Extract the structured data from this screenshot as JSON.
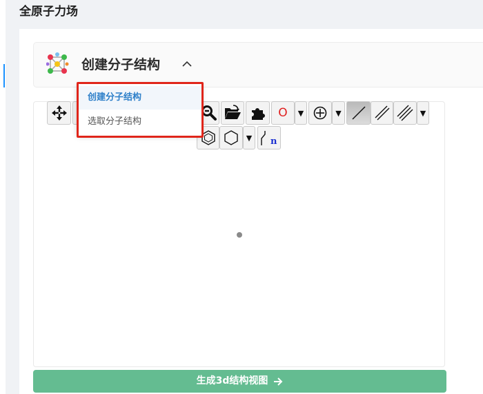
{
  "page": {
    "title": "全原子力场"
  },
  "header": {
    "title": "创建分子结构"
  },
  "dropdown": {
    "items": [
      {
        "label": "创建分子结构",
        "active": true
      },
      {
        "label": "选取分子结构",
        "active": false
      }
    ]
  },
  "toolbar": {
    "element_symbol": "O",
    "dropdown_arrow": "▼",
    "text_tool_label": "n"
  },
  "actions": {
    "generate_label": "生成3d结构视图"
  },
  "colors": {
    "accent": "#2d7fc9",
    "primary_button": "#64bc91",
    "highlight": "#e0251a",
    "element_color": "#e02020"
  },
  "icons": {
    "logo": "molecule-structure-icon",
    "toggle": "chevron-up-icon",
    "move": "move-arrows-icon",
    "zoom": "zoom-out-icon",
    "open": "folder-open-icon",
    "template": "puzzle-icon",
    "charge": "circle-plus-icon",
    "single_bond": "single-bond-icon",
    "double_bond": "double-bond-icon",
    "triple_bond": "triple-bond-icon",
    "benzene": "benzene-icon",
    "ring": "hexagon-icon",
    "chain": "chain-icon",
    "generate": "arrow-right-icon"
  }
}
